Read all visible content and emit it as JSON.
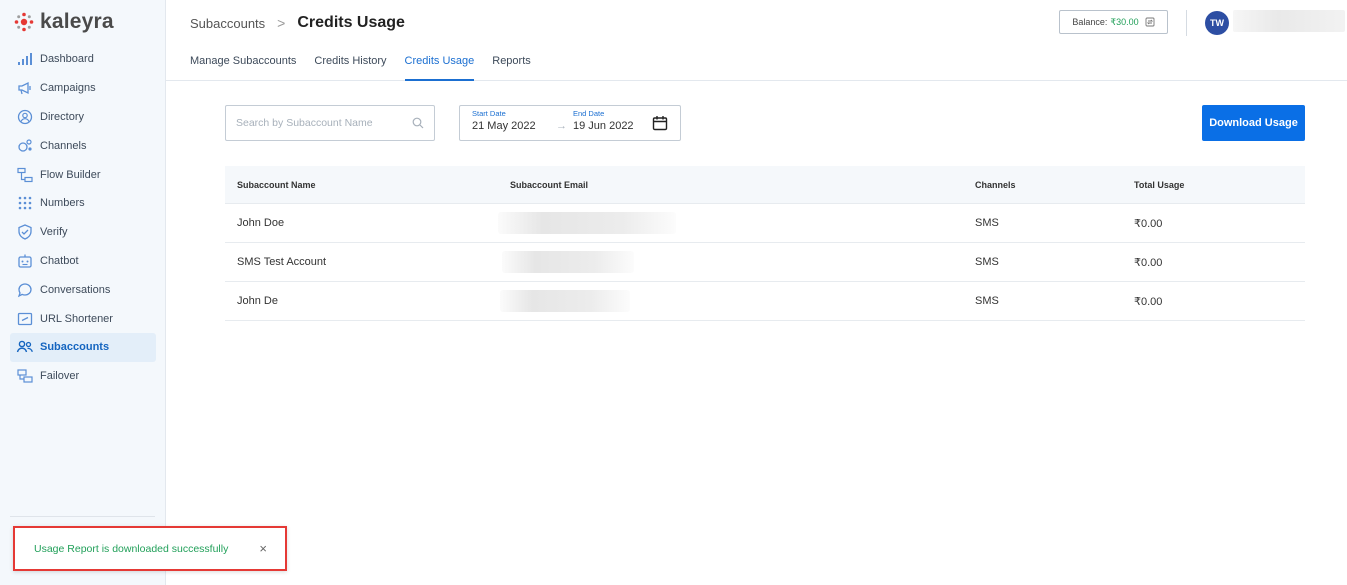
{
  "brand": {
    "name": "kaleyra",
    "accent": "#e53935"
  },
  "sidebar": {
    "items": [
      {
        "label": "Dashboard",
        "icon": "bar-chart-icon"
      },
      {
        "label": "Campaigns",
        "icon": "megaphone-icon"
      },
      {
        "label": "Directory",
        "icon": "person-circle-icon"
      },
      {
        "label": "Channels",
        "icon": "channels-icon"
      },
      {
        "label": "Flow Builder",
        "icon": "flow-icon"
      },
      {
        "label": "Numbers",
        "icon": "grid-dots-icon"
      },
      {
        "label": "Verify",
        "icon": "shield-check-icon"
      },
      {
        "label": "Chatbot",
        "icon": "robot-icon"
      },
      {
        "label": "Conversations",
        "icon": "chat-bubble-icon"
      },
      {
        "label": "URL Shortener",
        "icon": "link-box-icon"
      },
      {
        "label": "Subaccounts",
        "icon": "users-icon",
        "active": true
      },
      {
        "label": "Failover",
        "icon": "failover-icon"
      }
    ]
  },
  "header": {
    "breadcrumb_parent": "Subaccounts",
    "breadcrumb_separator": ">",
    "title": "Credits Usage",
    "balance_label": "Balance:",
    "balance_value": "₹30.00",
    "avatar_initials": "TW",
    "tabs": [
      {
        "label": "Manage Subaccounts"
      },
      {
        "label": "Credits History"
      },
      {
        "label": "Credits Usage",
        "active": true
      },
      {
        "label": "Reports"
      }
    ]
  },
  "filters": {
    "search_placeholder": "Search by Subaccount Name",
    "start_date_label": "Start Date",
    "start_date_value": "21 May 2022",
    "date_arrow": "→",
    "end_date_label": "End Date",
    "end_date_value": "19 Jun 2022",
    "download_label": "Download Usage"
  },
  "table": {
    "headers": [
      "Subaccount Name",
      "Subaccount Email",
      "Channels",
      "Total Usage"
    ],
    "rows": [
      {
        "name": "John Doe",
        "channel": "SMS",
        "usage": "₹0.00"
      },
      {
        "name": "SMS Test Account",
        "channel": "SMS",
        "usage": "₹0.00"
      },
      {
        "name": "John De",
        "channel": "SMS",
        "usage": "₹0.00"
      }
    ]
  },
  "toast": {
    "message": "Usage Report is downloaded successfully",
    "close": "×"
  },
  "colors": {
    "primary": "#0a6fe6",
    "success": "#22a05a",
    "avatar": "#2d4ea3"
  }
}
